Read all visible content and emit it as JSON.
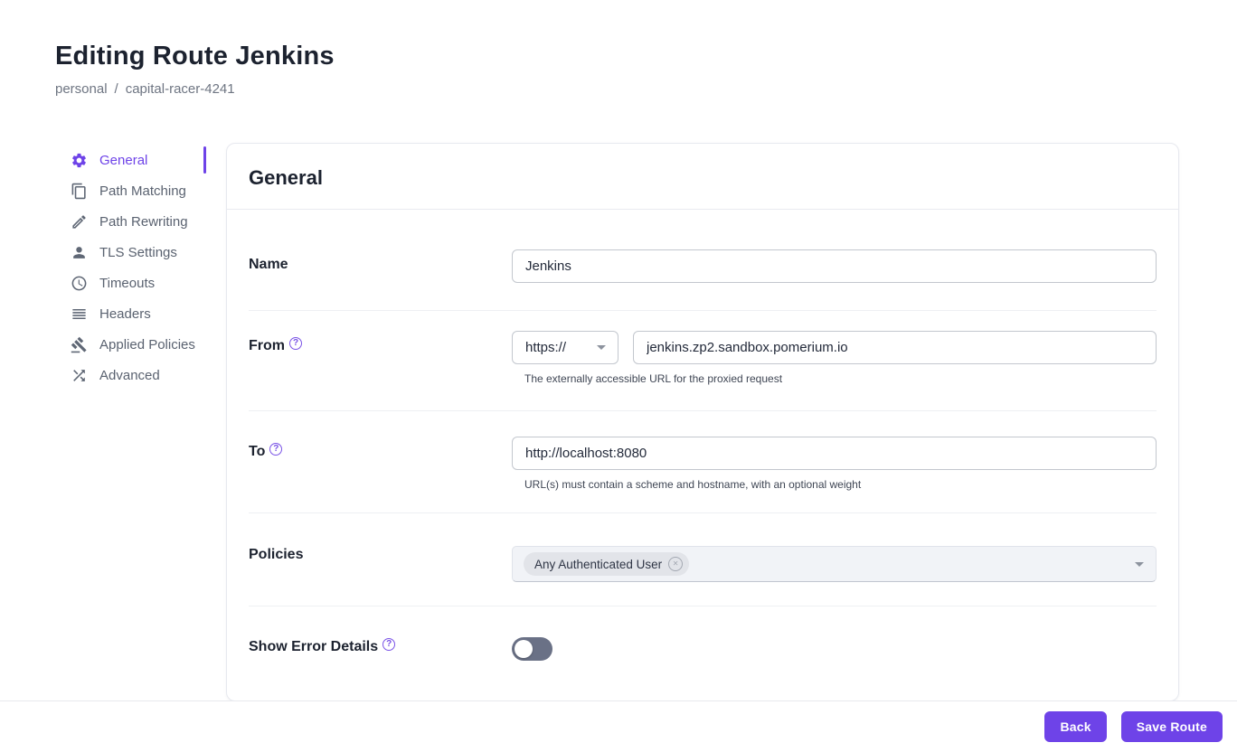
{
  "colors": {
    "accent": "#6e43e8",
    "title_text": "#1c222f",
    "muted_text": "#6e7582",
    "toggle_track_off": "#6a7186",
    "policies_field_bg": "#f1f3f7"
  },
  "header": {
    "title": "Editing Route Jenkins",
    "breadcrumb": {
      "items": [
        "personal",
        "capital-racer-4241"
      ],
      "separator": "/"
    }
  },
  "sidebar": {
    "items": [
      {
        "label": "General",
        "icon": "gear-icon",
        "active": true
      },
      {
        "label": "Path Matching",
        "icon": "copy-icon",
        "active": false
      },
      {
        "label": "Path Rewriting",
        "icon": "pencil-icon",
        "active": false
      },
      {
        "label": "TLS Settings",
        "icon": "person-icon",
        "active": false
      },
      {
        "label": "Timeouts",
        "icon": "clock-icon",
        "active": false
      },
      {
        "label": "Headers",
        "icon": "list-lines-icon",
        "active": false
      },
      {
        "label": "Applied Policies",
        "icon": "gavel-icon",
        "active": false
      },
      {
        "label": "Advanced",
        "icon": "shuffle-icon",
        "active": false
      }
    ]
  },
  "panel": {
    "title": "General",
    "fields": {
      "name": {
        "label": "Name",
        "value": "Jenkins"
      },
      "from": {
        "label": "From",
        "scheme": "https://",
        "host": "jenkins.zp2.sandbox.pomerium.io",
        "helper": "The externally accessible URL for the proxied request"
      },
      "to": {
        "label": "To",
        "value": "http://localhost:8080",
        "helper": "URL(s) must contain a scheme and hostname, with an optional weight"
      },
      "policies": {
        "label": "Policies",
        "selected": [
          {
            "label": "Any Authenticated User"
          }
        ]
      },
      "show_error_details": {
        "label": "Show Error Details",
        "enabled": false
      }
    }
  },
  "footer": {
    "back_label": "Back",
    "save_label": "Save Route"
  },
  "icons": {
    "help_glyph": "?",
    "chip_remove_glyph": "✕"
  }
}
